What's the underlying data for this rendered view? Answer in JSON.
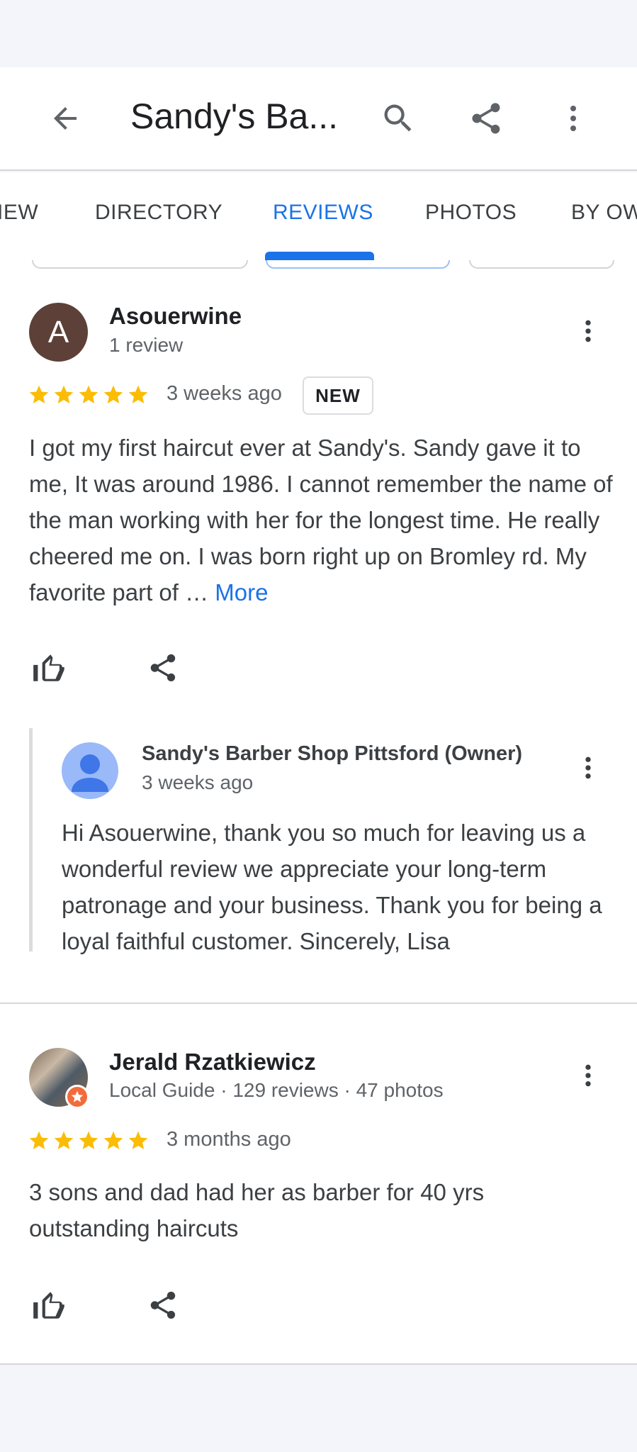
{
  "appbar": {
    "title": "Sandy's Ba...",
    "icons": [
      "arrow-back-icon",
      "search-icon",
      "share-icon",
      "more-vert-icon"
    ]
  },
  "tabs": [
    {
      "label": "IEW",
      "active": false
    },
    {
      "label": "DIRECTORY",
      "active": false
    },
    {
      "label": "REVIEWS",
      "active": true
    },
    {
      "label": "PHOTOS",
      "active": false
    },
    {
      "label": "BY OW",
      "active": false
    }
  ],
  "colors": {
    "accent": "#1a73e8",
    "star": "#fbbc04",
    "avatar_a": "#5d4037",
    "guide_badge": "#f26b3a"
  },
  "reviews": [
    {
      "author_initial": "A",
      "author": "Asouerwine",
      "author_meta": "1 review",
      "rating": 5,
      "date": "3 weeks ago",
      "badge": "NEW",
      "text": "I got my first haircut ever at Sandy's. Sandy gave it to me, It was around 1986. I cannot remember the name of the man working with her for the longest time. He really cheered me on. I was born right up on Bromley rd. My favorite part of … ",
      "more_label": "More",
      "owner_reply": {
        "name": "Sandy's Barber Shop Pittsford (Owner)",
        "date": "3 weeks ago",
        "text": "Hi Asouerwine, thank you so much for leaving us a wonderful review we appreciate your long-term patronage and your business. Thank you for being a loyal faithful customer. Sincerely, Lisa"
      }
    },
    {
      "author": "Jerald Rzatkiewicz",
      "author_meta": "Local Guide · 129 reviews · 47 photos",
      "rating": 5,
      "date": "3 months ago",
      "text": "3 sons and dad had her as barber for 40 yrs outstanding haircuts"
    }
  ]
}
